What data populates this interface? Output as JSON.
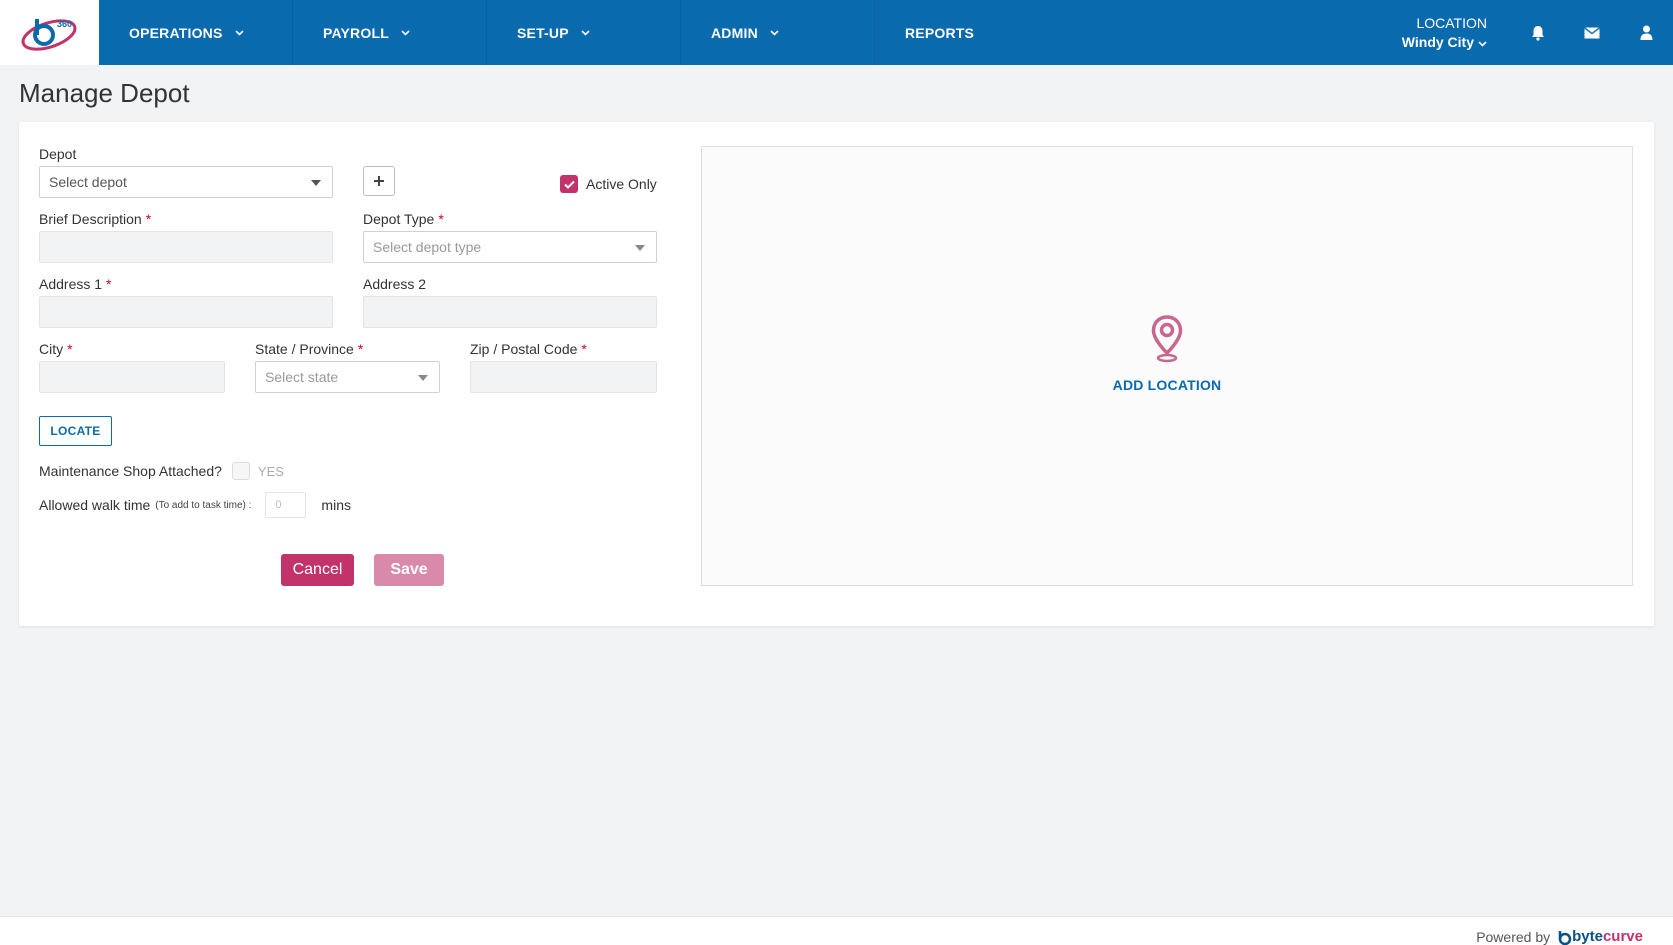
{
  "nav": {
    "items": [
      {
        "label": "OPERATIONS"
      },
      {
        "label": "PAYROLL"
      },
      {
        "label": "SET-UP"
      },
      {
        "label": "ADMIN"
      },
      {
        "label": "REPORTS"
      }
    ],
    "location_label": "LOCATION",
    "location_value": "Windy City",
    "logo_text": "360"
  },
  "page": {
    "title": "Manage Depot"
  },
  "form": {
    "depot_label": "Depot",
    "depot_placeholder": "Select depot",
    "active_only_label": "Active Only",
    "brief_description_label": "Brief Description",
    "depot_type_label": "Depot Type",
    "depot_type_placeholder": "Select depot type",
    "address1_label": "Address 1",
    "address2_label": "Address 2",
    "city_label": "City",
    "state_label": "State / Province",
    "state_placeholder": "Select state",
    "zip_label": "Zip / Postal Code",
    "required_mark": "*",
    "locate_label": "LOCATE",
    "maintenance_label": "Maintenance Shop Attached?",
    "maintenance_yes": "YES",
    "walk_label": "Allowed walk time",
    "walk_note": "(To add to task time) :",
    "walk_value": "0",
    "walk_unit": "mins",
    "cancel_label": "Cancel",
    "save_label": "Save"
  },
  "map": {
    "add_location_label": "ADD LOCATION"
  },
  "footer": {
    "powered_by": "Powered by",
    "brand_a": "byte",
    "brand_b": "curve"
  },
  "colors": {
    "primary": "#0a6aae",
    "accent": "#c2326b",
    "accent_disabled": "#d98aaa"
  }
}
